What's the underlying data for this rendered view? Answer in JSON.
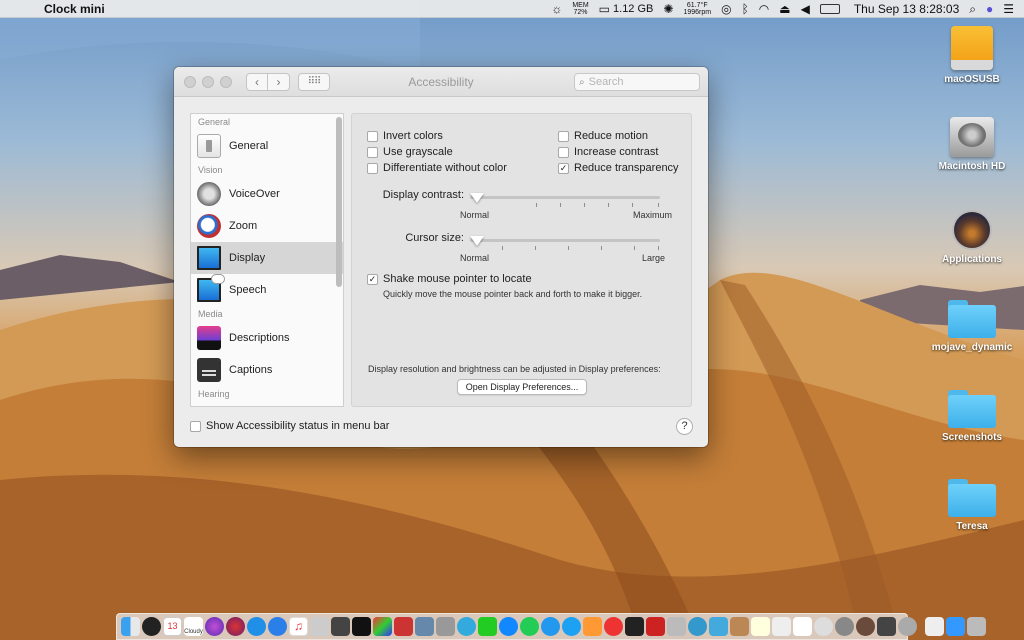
{
  "menubar": {
    "app_name": "Clock mini",
    "mem_label": "MEM",
    "mem_value": "72%",
    "storage": "1.12 GB",
    "temp": "61.7°F",
    "rpm": "1996rpm",
    "battery": "",
    "clock": "Thu Sep 13  8:28:03"
  },
  "desktop_icons": [
    {
      "label": "macOSUSB",
      "icon": "usb-drive-icon"
    },
    {
      "label": "Macintosh HD",
      "icon": "hard-drive-icon"
    },
    {
      "label": "Applications",
      "icon": "applications-icon"
    },
    {
      "label": "mojave_dynamic",
      "icon": "folder-icon"
    },
    {
      "label": "Screenshots",
      "icon": "folder-icon"
    },
    {
      "label": "Teresa",
      "icon": "folder-icon"
    }
  ],
  "window": {
    "title": "Accessibility",
    "search_placeholder": "Search"
  },
  "sidebar": {
    "sections": [
      {
        "label": "General",
        "items": [
          {
            "label": "General",
            "icon": "general-icon"
          }
        ]
      },
      {
        "label": "Vision",
        "items": [
          {
            "label": "VoiceOver",
            "icon": "voiceover-icon"
          },
          {
            "label": "Zoom",
            "icon": "zoom-icon"
          },
          {
            "label": "Display",
            "icon": "display-icon",
            "selected": true
          },
          {
            "label": "Speech",
            "icon": "speech-icon"
          }
        ]
      },
      {
        "label": "Media",
        "items": [
          {
            "label": "Descriptions",
            "icon": "descriptions-icon"
          },
          {
            "label": "Captions",
            "icon": "captions-icon"
          }
        ]
      },
      {
        "label": "Hearing",
        "items": []
      }
    ]
  },
  "display": {
    "checkboxes_left": [
      {
        "label": "Invert colors",
        "checked": false
      },
      {
        "label": "Use grayscale",
        "checked": false
      },
      {
        "label": "Differentiate without color",
        "checked": false
      }
    ],
    "checkboxes_right": [
      {
        "label": "Reduce motion",
        "checked": false
      },
      {
        "label": "Increase contrast",
        "checked": false
      },
      {
        "label": "Reduce transparency",
        "checked": true
      }
    ],
    "contrast": {
      "label": "Display contrast:",
      "min_label": "Normal",
      "max_label": "Maximum",
      "value": 0
    },
    "cursor": {
      "label": "Cursor size:",
      "min_label": "Normal",
      "max_label": "Large",
      "value": 0
    },
    "shake": {
      "label": "Shake mouse pointer to locate",
      "checked": true,
      "hint": "Quickly move the mouse pointer back and forth to make it bigger."
    },
    "resolution_note": "Display resolution and brightness can be adjusted in Display preferences:",
    "open_prefs_button": "Open Display Preferences..."
  },
  "footer": {
    "show_status_label": "Show Accessibility status in menu bar",
    "show_status_checked": false,
    "help_label": "?"
  },
  "dock": {
    "calendar_day": "13",
    "weather_label": "Cloudy"
  }
}
